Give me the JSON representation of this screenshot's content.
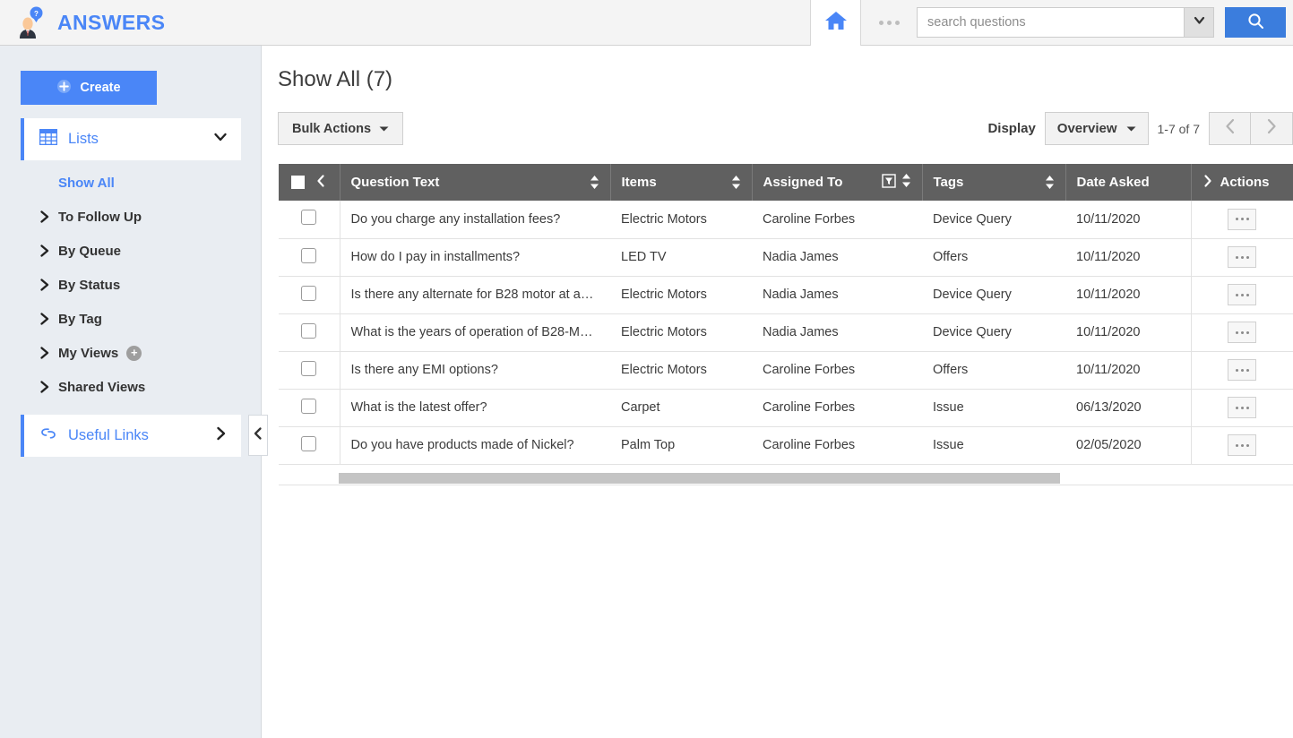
{
  "header": {
    "brand": "ANSWERS",
    "logo_icon": "person-question-bubble-icon",
    "home_icon": "home-icon",
    "more_icon": "ellipsis-icon",
    "search": {
      "placeholder": "search questions",
      "value": "",
      "dropdown_icon": "chevron-down-icon",
      "search_icon": "search-icon"
    },
    "brand_color": "#4a86f7",
    "search_button_color": "#3b7ddd"
  },
  "sidebar": {
    "create_label": "Create",
    "create_icon": "plus-circle-icon",
    "sections": {
      "lists": {
        "label": "Lists",
        "icon": "grid-table-icon",
        "chevron": "chevron-down-icon"
      },
      "useful_links": {
        "label": "Useful Links",
        "icon": "link-icon",
        "chevron": "chevron-right-icon"
      }
    },
    "items": [
      {
        "label": "Show All",
        "active": true,
        "arrow": ""
      },
      {
        "label": "To Follow Up",
        "active": false,
        "arrow": "chevron-right-icon"
      },
      {
        "label": "By Queue",
        "active": false,
        "arrow": "chevron-right-icon"
      },
      {
        "label": "By Status",
        "active": false,
        "arrow": "chevron-right-icon"
      },
      {
        "label": "By Tag",
        "active": false,
        "arrow": "chevron-right-icon"
      },
      {
        "label": "My Views",
        "active": false,
        "arrow": "chevron-right-icon",
        "add_icon": "plus-circle-icon"
      },
      {
        "label": "Shared Views",
        "active": false,
        "arrow": "chevron-right-icon"
      }
    ],
    "collapse_icon": "chevron-left-icon",
    "background_color": "#e9edf2",
    "accent_color": "#4a86f7"
  },
  "main": {
    "page_title": "Show All (7)",
    "toolbar": {
      "bulk_actions_label": "Bulk Actions",
      "bulk_actions_caret": "caret-down-icon",
      "display_label": "Display",
      "display_value": "Overview",
      "display_caret": "caret-down-icon",
      "range_text": "1-7 of 7",
      "prev_icon": "chevron-left-icon",
      "next_icon": "chevron-right-icon"
    },
    "table": {
      "header_color": "#606060",
      "select_all_checkbox": "checkbox-checked-square",
      "collapse_columns_icon": "chevron-left-icon",
      "expand_actions_icon": "chevron-right-icon",
      "columns": [
        {
          "label": "Question Text",
          "sort_icon": "sort-updown-icon",
          "filter_icon": ""
        },
        {
          "label": "Items",
          "sort_icon": "sort-updown-icon",
          "filter_icon": ""
        },
        {
          "label": "Assigned To",
          "sort_icon": "sort-updown-icon",
          "filter_icon": "funnel-filter-icon"
        },
        {
          "label": "Tags",
          "sort_icon": "sort-updown-icon",
          "filter_icon": ""
        },
        {
          "label": "Date Asked",
          "sort_icon": "",
          "filter_icon": ""
        },
        {
          "label": "Actions",
          "sort_icon": "",
          "filter_icon": ""
        }
      ],
      "rows": [
        {
          "question": "Do you charge any installation fees?",
          "items": "Electric Motors",
          "assigned_to": "Caroline Forbes",
          "tags": "Device Query",
          "date_asked": "10/11/2020",
          "action_icon": "ellipsis-icon"
        },
        {
          "question": "How do I pay in installments?",
          "items": "LED TV",
          "assigned_to": "Nadia James",
          "tags": "Offers",
          "date_asked": "10/11/2020",
          "action_icon": "ellipsis-icon"
        },
        {
          "question": "Is there any alternate for B28 motor at an…",
          "items": "Electric Motors",
          "assigned_to": "Nadia James",
          "tags": "Device Query",
          "date_asked": "10/11/2020",
          "action_icon": "ellipsis-icon"
        },
        {
          "question": "What is the years of operation of B28-Mo…",
          "items": "Electric Motors",
          "assigned_to": "Nadia James",
          "tags": "Device Query",
          "date_asked": "10/11/2020",
          "action_icon": "ellipsis-icon"
        },
        {
          "question": "Is there any EMI options?",
          "items": "Electric Motors",
          "assigned_to": "Caroline Forbes",
          "tags": "Offers",
          "date_asked": "10/11/2020",
          "action_icon": "ellipsis-icon"
        },
        {
          "question": "What is the latest offer?",
          "items": "Carpet",
          "assigned_to": "Caroline Forbes",
          "tags": "Issue",
          "date_asked": "06/13/2020",
          "action_icon": "ellipsis-icon"
        },
        {
          "question": "Do you have products made of Nickel?",
          "items": "Palm Top",
          "assigned_to": "Caroline Forbes",
          "tags": "Issue",
          "date_asked": "02/05/2020",
          "action_icon": "ellipsis-icon"
        }
      ]
    }
  }
}
